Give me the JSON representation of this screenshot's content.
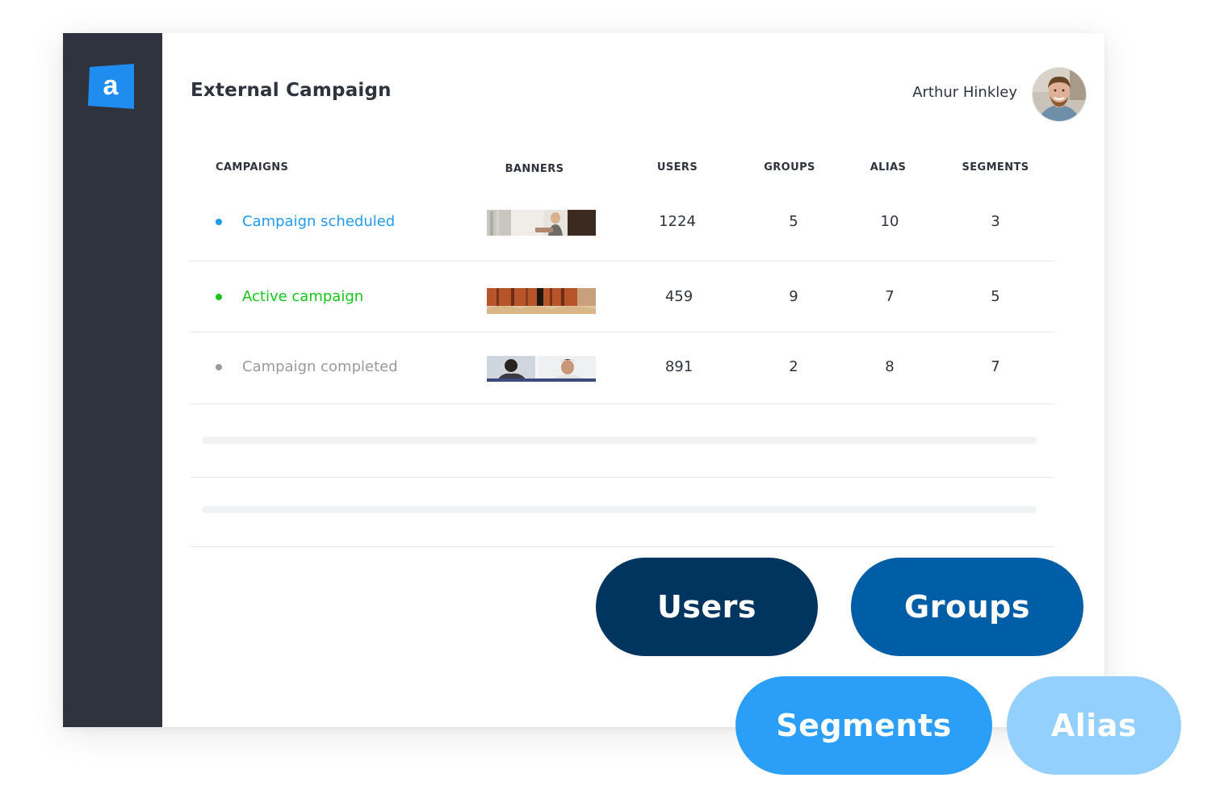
{
  "header": {
    "title": "External Campaign",
    "user_name": "Arthur Hinkley",
    "logo_letter": "a"
  },
  "table": {
    "columns": {
      "campaigns": "CAMPAIGNS",
      "banners": "BANNERS",
      "users": "USERS",
      "groups": "GROUPS",
      "alias": "ALIAS",
      "segments": "SEGMENTS"
    },
    "rows": [
      {
        "name": "Campaign scheduled",
        "status_color": "#1f9bf0",
        "users": "1224",
        "groups": "5",
        "alias": "10",
        "segments": "3"
      },
      {
        "name": "Active campaign",
        "status_color": "#14c61c",
        "users": "459",
        "groups": "9",
        "alias": "7",
        "segments": "5"
      },
      {
        "name": "Campaign completed",
        "status_color": "#9b9b9b",
        "users": "891",
        "groups": "2",
        "alias": "8",
        "segments": "7"
      }
    ]
  },
  "pills": {
    "users": {
      "label": "Users",
      "color": "#003560"
    },
    "groups": {
      "label": "Groups",
      "color": "#005ea6"
    },
    "segments": {
      "label": "Segments",
      "color": "#2b9ef8"
    },
    "alias": {
      "label": "Alias",
      "color": "#94d0fd"
    }
  },
  "colors": {
    "sidebar": "#2f333e",
    "logo": "#1f8cf0"
  }
}
